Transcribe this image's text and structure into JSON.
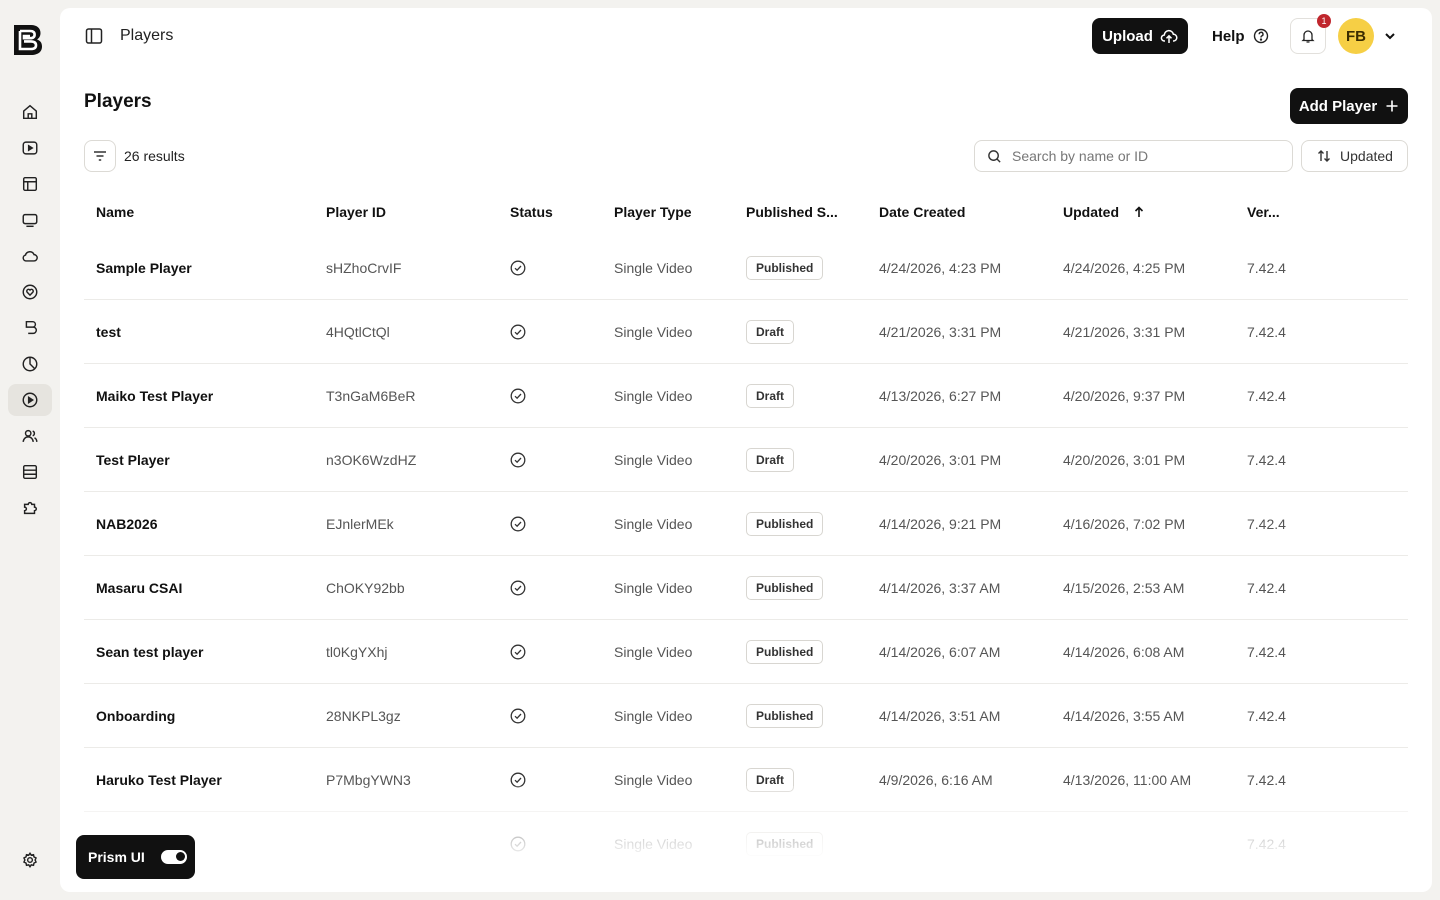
{
  "topbar": {
    "title": "Players",
    "upload_label": "Upload",
    "help_label": "Help",
    "notification_count": "1",
    "avatar_initials": "FB"
  },
  "page": {
    "title": "Players",
    "add_label": "Add Player",
    "results_text": "26 results",
    "search_placeholder": "Search by name or ID",
    "sort_label": "Updated"
  },
  "rail": {
    "items": [
      "home-icon",
      "video-icon",
      "library-icon",
      "monitor-icon",
      "cloud-icon",
      "shield-heart-icon",
      "brand-icon",
      "analytics-icon",
      "player-icon",
      "users-icon",
      "storage-icon",
      "puzzle-icon"
    ],
    "active": "player-icon",
    "settings": "settings-icon"
  },
  "table": {
    "columns": [
      "Name",
      "Player ID",
      "Status",
      "Player Type",
      "Published S...",
      "Date Created",
      "Updated",
      "Ver..."
    ],
    "rows": [
      {
        "name": "Sample Player",
        "id": "sHZhoCrvIF",
        "type": "Single Video",
        "published": "Published",
        "created": "4/24/2026, 4:23 PM",
        "updated": "4/24/2026, 4:25 PM",
        "version": "7.42.4"
      },
      {
        "name": "test",
        "id": "4HQtlCtQl",
        "type": "Single Video",
        "published": "Draft",
        "created": "4/21/2026, 3:31 PM",
        "updated": "4/21/2026, 3:31 PM",
        "version": "7.42.4"
      },
      {
        "name": "Maiko Test Player",
        "id": "T3nGaM6BeR",
        "type": "Single Video",
        "published": "Draft",
        "created": "4/13/2026, 6:27 PM",
        "updated": "4/20/2026, 9:37 PM",
        "version": "7.42.4"
      },
      {
        "name": "Test Player",
        "id": "n3OK6WzdHZ",
        "type": "Single Video",
        "published": "Draft",
        "created": "4/20/2026, 3:01 PM",
        "updated": "4/20/2026, 3:01 PM",
        "version": "7.42.4"
      },
      {
        "name": "NAB2026",
        "id": "EJnlerMEk",
        "type": "Single Video",
        "published": "Published",
        "created": "4/14/2026, 9:21 PM",
        "updated": "4/16/2026, 7:02 PM",
        "version": "7.42.4"
      },
      {
        "name": "Masaru CSAI",
        "id": "ChOKY92bb",
        "type": "Single Video",
        "published": "Published",
        "created": "4/14/2026, 3:37 AM",
        "updated": "4/15/2026, 2:53 AM",
        "version": "7.42.4"
      },
      {
        "name": "Sean test player",
        "id": "tl0KgYXhj",
        "type": "Single Video",
        "published": "Published",
        "created": "4/14/2026, 6:07 AM",
        "updated": "4/14/2026, 6:08 AM",
        "version": "7.42.4"
      },
      {
        "name": "Onboarding",
        "id": "28NKPL3gz",
        "type": "Single Video",
        "published": "Published",
        "created": "4/14/2026, 3:51 AM",
        "updated": "4/14/2026, 3:55 AM",
        "version": "7.42.4"
      },
      {
        "name": "Haruko Test Player",
        "id": "P7MbgYWN3",
        "type": "Single Video",
        "published": "Draft",
        "created": "4/9/2026, 6:16 AM",
        "updated": "4/13/2026, 11:00 AM",
        "version": "7.42.4"
      },
      {
        "name": "",
        "id": "",
        "type": "Single Video",
        "published": "Published",
        "created": "",
        "updated": "",
        "version": "7.42.4"
      }
    ]
  },
  "prism": {
    "label": "Prism UI",
    "enabled": true
  }
}
